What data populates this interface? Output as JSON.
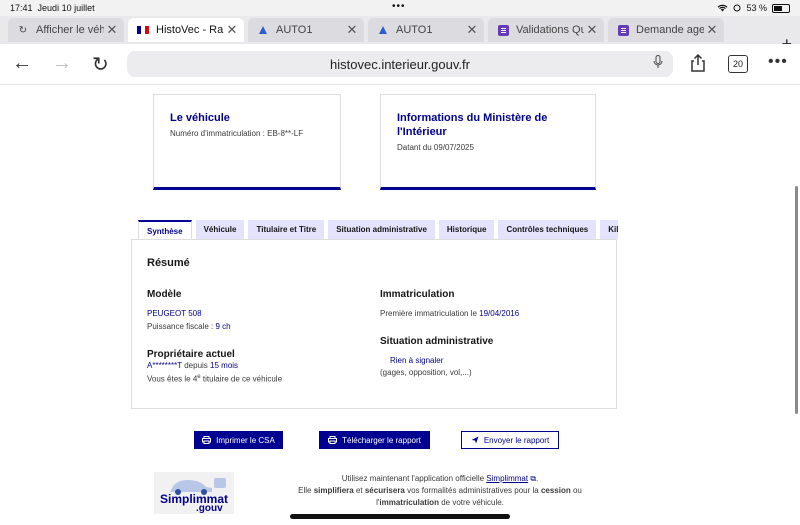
{
  "status": {
    "time": "17:41",
    "date": "Jeudi 10 juillet",
    "battery": "53 %"
  },
  "tabs": [
    {
      "title": "Afficher le véh",
      "active": false
    },
    {
      "title": "HistoVec - Rapp",
      "active": true
    },
    {
      "title": "AUTO1",
      "active": false
    },
    {
      "title": "AUTO1",
      "active": false
    },
    {
      "title": "Validations Qua",
      "active": false
    },
    {
      "title": "Demande agem",
      "active": false
    }
  ],
  "browser": {
    "url": "histovec.interieur.gouv.fr",
    "tab_count": "20"
  },
  "cards": {
    "vehicle": {
      "title": "Le véhicule",
      "text": "Numéro d'immatriculation : EB-8**-LF"
    },
    "ministry": {
      "title": "Informations du Ministère de l'Intérieur",
      "text": "Datant du 09/07/2025"
    }
  },
  "page_tabs": [
    "Synthèse",
    "Véhicule",
    "Titulaire et Titre",
    "Situation administrative",
    "Historique",
    "Contrôles techniques",
    "Kilo"
  ],
  "summary": {
    "heading": "Résumé",
    "model_heading": "Modèle",
    "model_value": "PEUGEOT 508",
    "power_label": "Puissance fiscale :",
    "power_value": "9 ch",
    "owner_heading": "Propriétaire actuel",
    "owner_name": "A********T",
    "owner_since_label": "depuis",
    "owner_since_value": "15 mois",
    "holder_pre": "Vous êtes le",
    "holder_num": "4",
    "holder_sup": "e",
    "holder_post": "titulaire de ce véhicule",
    "registration_heading": "Immatriculation",
    "registration_label": "Première immatriculation le",
    "registration_date": "19/04/2016",
    "admin_heading": "Situation administrative",
    "admin_value": "Rien à signaler",
    "admin_note": "(gages, opposition, vol,...)"
  },
  "buttons": {
    "print": "Imprimer le CSA",
    "download": "Télécharger le rapport",
    "send": "Envoyer le rapport"
  },
  "promo": {
    "logo_top": "Simplimmat",
    "logo_bottom": ".gouv",
    "line1_pre": "Utilisez maintenant l'application officielle",
    "link": "Simplimmat",
    "line1_post": ".",
    "line2_pre": "Elle",
    "simplify": "simplifiera",
    "and": "et",
    "secure": "sécurisera",
    "line2_mid": "vos formalités administratives pour la",
    "cession": "cession",
    "or": "ou",
    "line3_pre": "l'",
    "immat": "immatriculation",
    "line3_post": "de votre véhicule."
  },
  "colors": {
    "accent": "#000091",
    "tab_bg": "#e3e3fd"
  }
}
